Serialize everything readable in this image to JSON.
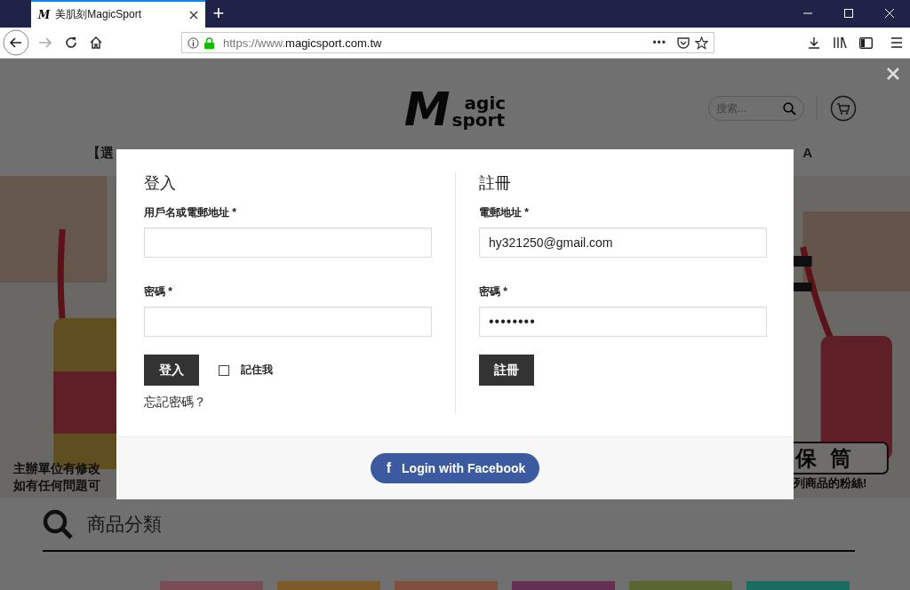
{
  "browser": {
    "tab": {
      "favicon": "M",
      "title": "美肌刻MagicSport",
      "selected": true
    },
    "new_tab": "+",
    "url_prefix": "https://www.",
    "url_domain": "magicsport.com.tw",
    "page_actions": "•••"
  },
  "site": {
    "logo": {
      "initial": "M",
      "top": "agic",
      "bottom": "sport"
    },
    "search_placeholder": "搜索...",
    "nav_fragments": [
      "【選",
      "A"
    ],
    "hero_left_lines": [
      "主辦單位有修改",
      "如有任何問題可"
    ],
    "hero_right_title": "保 筒",
    "hero_right_sub": "列商品的粉絲!",
    "category_heading": "商品分類",
    "category_tiles": [
      {
        "color": "#7a4c55"
      },
      {
        "color": "#7d5a2a"
      },
      {
        "color": "#80503e"
      },
      {
        "color": "#633053"
      },
      {
        "color": "#5b6532"
      },
      {
        "color": "#1a6b60"
      }
    ]
  },
  "modal": {
    "login": {
      "title": "登入",
      "username_label": "用戶名或電郵地址 *",
      "password_label": "密碼 *",
      "button": "登入",
      "remember": {
        "label": "記住我",
        "checked": false
      },
      "forgot": "忘記密碼？"
    },
    "register": {
      "title": "註冊",
      "email_label": "電郵地址 *",
      "email_value": "hy321250@gmail.com",
      "password_label": "密碼 *",
      "password_mask": "••••••••",
      "button": "註冊"
    },
    "facebook_button": {
      "icon": "f",
      "label": "Login with Facebook"
    }
  }
}
